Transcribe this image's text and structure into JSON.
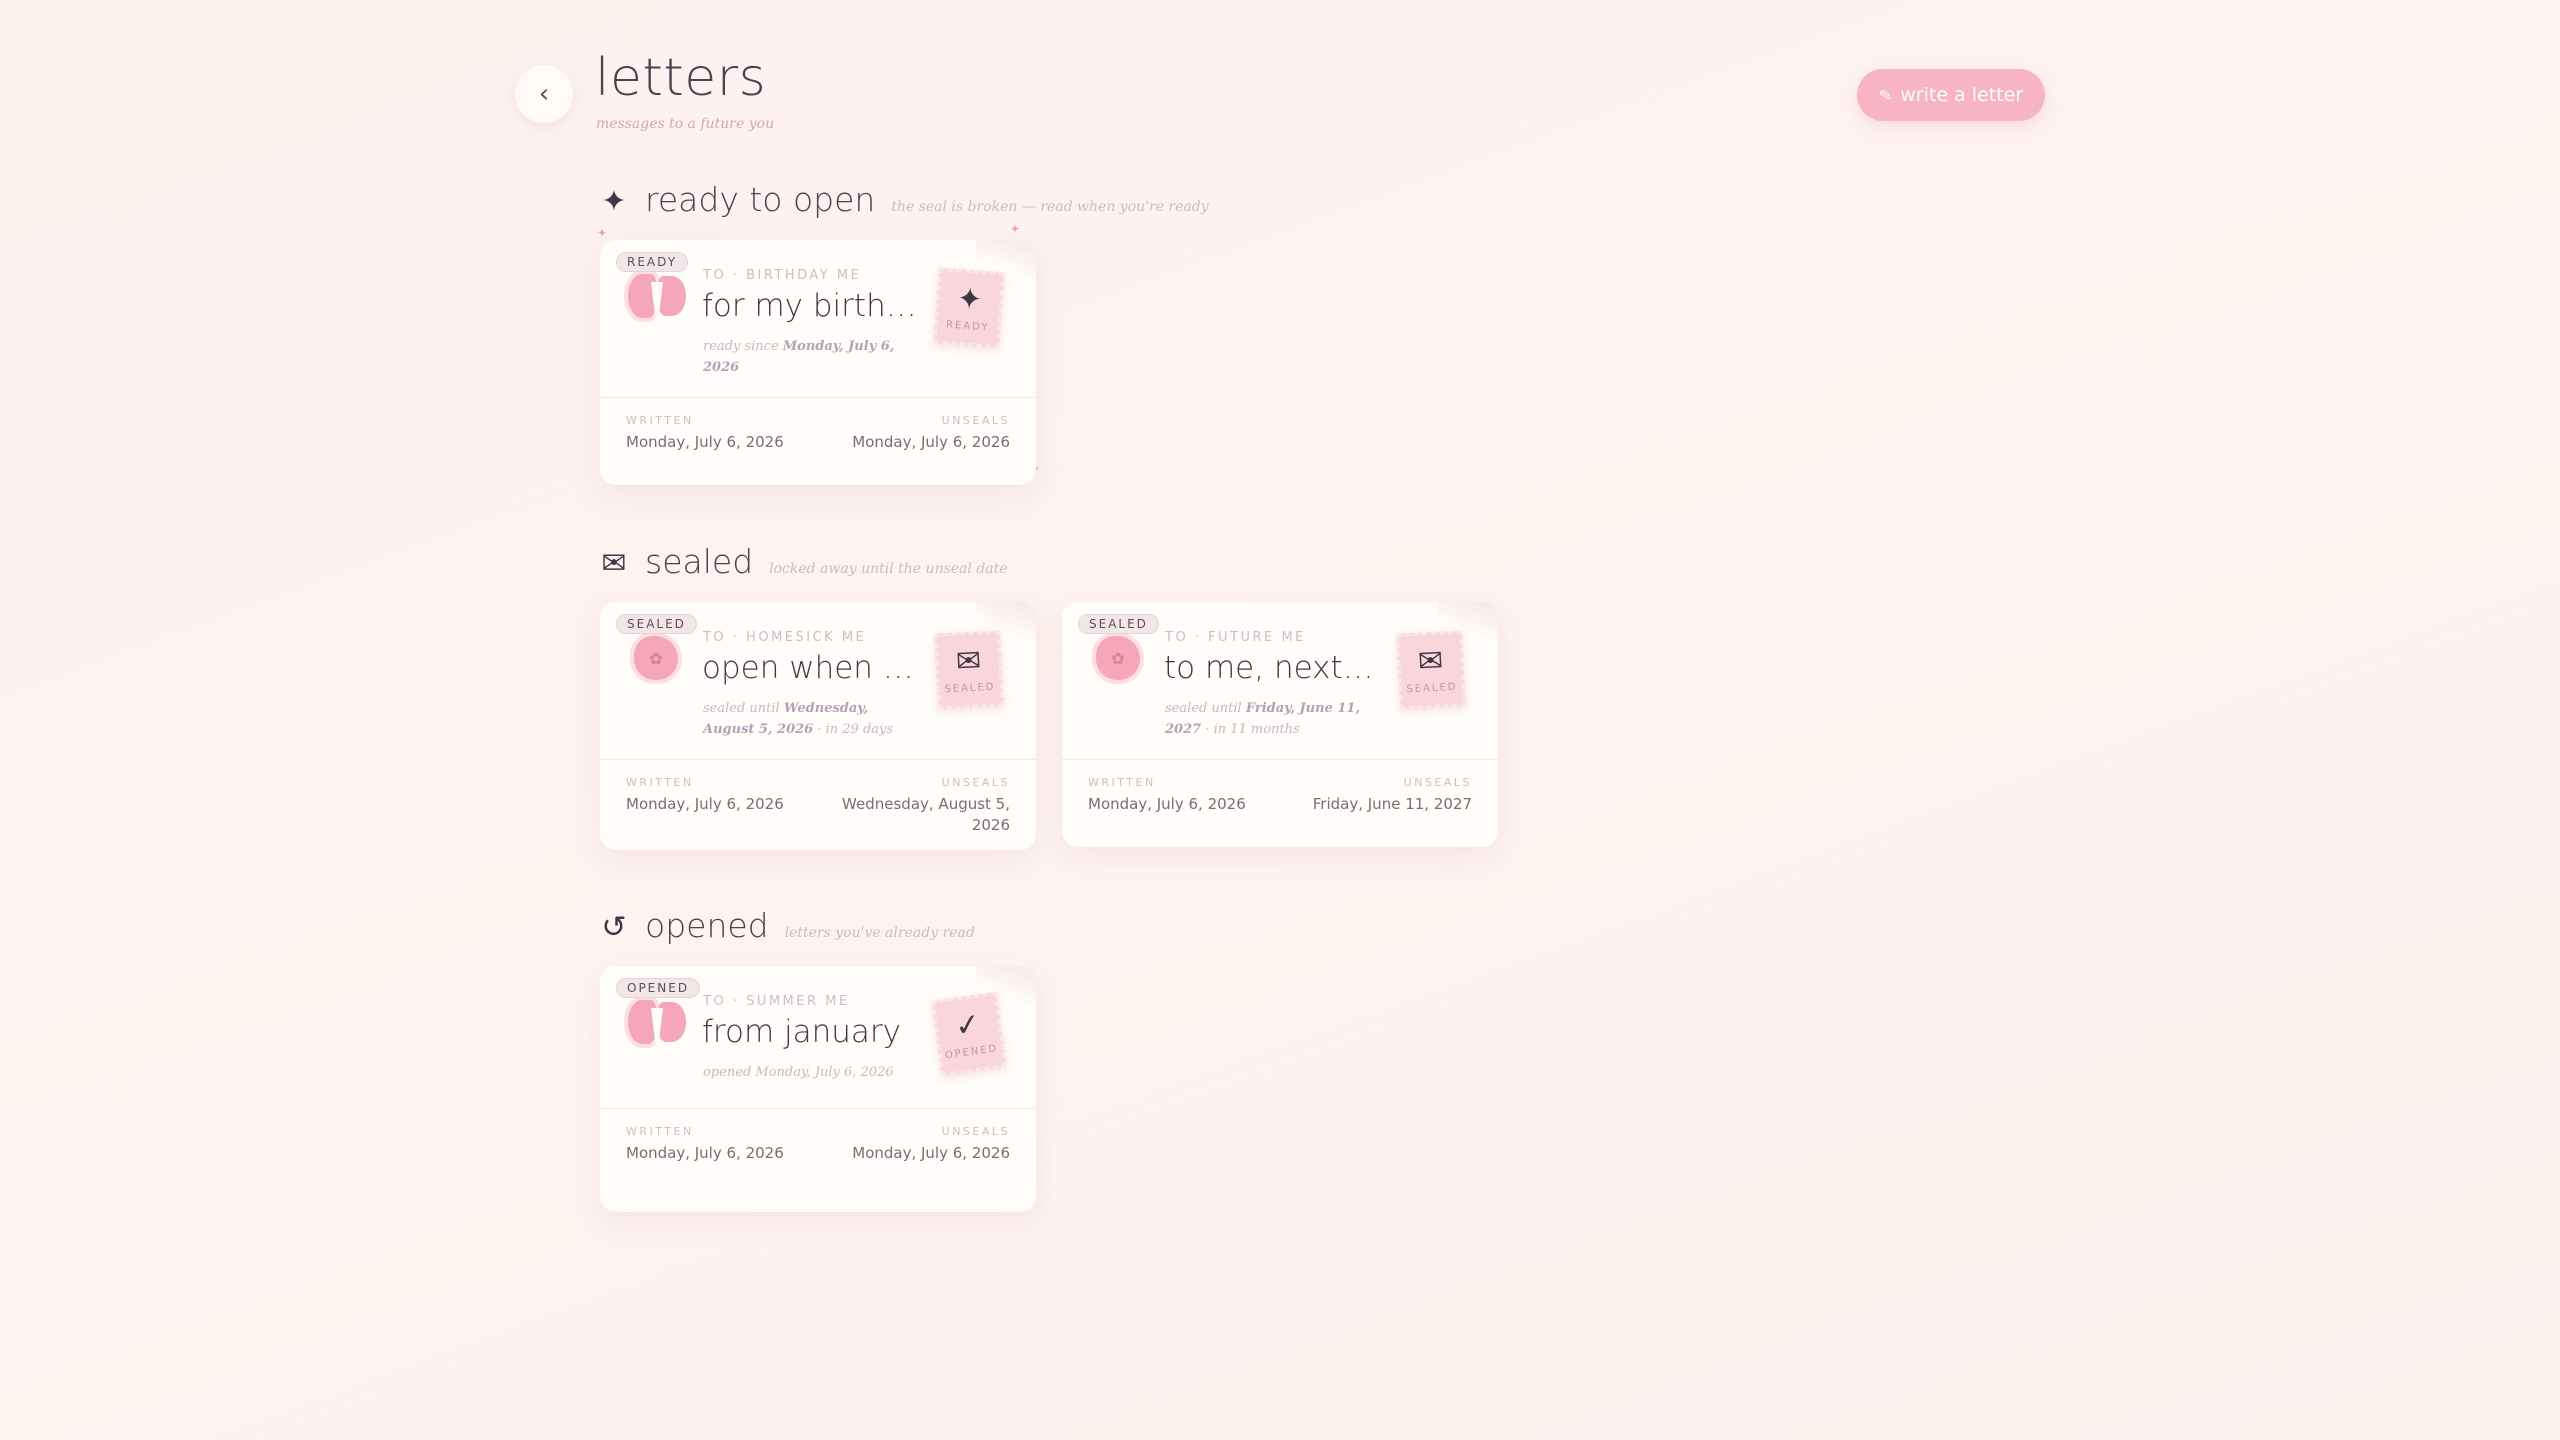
{
  "header": {
    "back_icon": "chevron-left-icon",
    "title": "letters",
    "subtitle": "messages to a future you",
    "write_button": "write a letter",
    "write_icon": "pen-icon"
  },
  "sections": {
    "ready": {
      "icon": "✦",
      "name": "ready to open",
      "hint": "the seal is broken — read when you're ready"
    },
    "sealed": {
      "icon": "✉",
      "name": "sealed",
      "hint": "locked away until the unseal date"
    },
    "opened": {
      "icon": "↺",
      "name": "opened",
      "hint": "letters you've already read"
    }
  },
  "cards": {
    "birthday": {
      "badge": "READY",
      "to": "TO · BIRTHDAY ME",
      "title": "for my birthday",
      "meta_prefix": "ready since ",
      "meta_date": "Monday, July 6, 2026",
      "meta_suffix": "",
      "stamp_icon": "✦",
      "stamp_label": "READY",
      "written_label": "WRITTEN",
      "written": "Monday, July 6, 2026",
      "unseals_label": "UNSEALS",
      "unseals": "Monday, July 6, 2026"
    },
    "homesick": {
      "badge": "SEALED",
      "to": "TO · HOMESICK ME",
      "title": "open when you",
      "meta_prefix": "sealed until ",
      "meta_date": "Wednesday, August 5, 2026",
      "meta_suffix": " · in 29 days",
      "stamp_icon": "✉",
      "stamp_label": "SEALED",
      "written_label": "WRITTEN",
      "written": "Monday, July 6, 2026",
      "unseals_label": "UNSEALS",
      "unseals": "Wednesday, August 5, 2026"
    },
    "future": {
      "badge": "SEALED",
      "to": "TO · FUTURE ME",
      "title": "to me, next summer",
      "meta_prefix": "sealed until ",
      "meta_date": "Friday, June 11, 2027",
      "meta_suffix": " · in 11 months",
      "stamp_icon": "✉",
      "stamp_label": "SEALED",
      "written_label": "WRITTEN",
      "written": "Monday, July 6, 2026",
      "unseals_label": "UNSEALS",
      "unseals": "Friday, June 11, 2027"
    },
    "summer": {
      "badge": "OPENED",
      "to": "TO · SUMMER ME",
      "title": "from january",
      "meta_prefix": "opened ",
      "meta_date": "Monday, July 6, 2026",
      "meta_suffix": "",
      "stamp_icon": "✓",
      "stamp_label": "OPENED",
      "written_label": "WRITTEN",
      "written": "Monday, July 6, 2026",
      "unseals_label": "UNSEALS",
      "unseals": "Monday, July 6, 2026"
    }
  },
  "colors": {
    "accent": "#f7b4c2",
    "seal": "#f5a6b8",
    "background": "#fdf2ef",
    "text": "#4b4150"
  }
}
